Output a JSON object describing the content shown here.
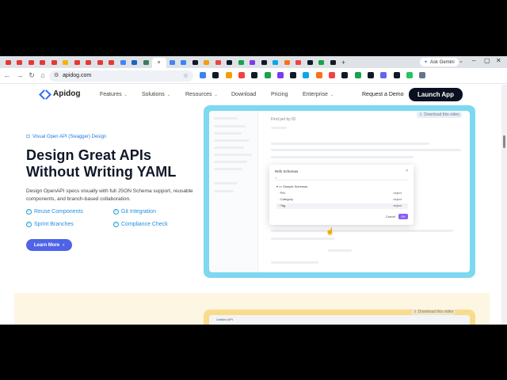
{
  "browser": {
    "tab_favicons": [
      "#e53935",
      "#e53935",
      "#e53935",
      "#e53935",
      "#e53935",
      "#f4b400",
      "#e53935",
      "#e53935",
      "#e53935",
      "#e53935",
      "#4285f4",
      "#1565c0",
      "#3a7c5a",
      "#4285f4"
    ],
    "active_tab_close": "×",
    "new_tab": "+",
    "ask_gemini": "Ask Gemini",
    "url": "apidog.com",
    "ext_colors": [
      "#3b82f6",
      "#111827",
      "#f59e0b",
      "#ef4444",
      "#111827",
      "#16a34a",
      "#7c3aed",
      "#111827",
      "#0ea5e9",
      "#f97316",
      "#ef4444",
      "#111827",
      "#16a34a",
      "#111827",
      "#6366f1",
      "#111827",
      "#22c55e",
      "#64748b"
    ]
  },
  "site": {
    "brand": "Apidog",
    "nav": [
      {
        "label": "Features",
        "caret": "⌄"
      },
      {
        "label": "Solutions",
        "caret": "⌄"
      },
      {
        "label": "Resources",
        "caret": "⌄"
      },
      {
        "label": "Download",
        "caret": ""
      },
      {
        "label": "Pricing",
        "caret": ""
      },
      {
        "label": "Enterprise",
        "caret": "⌄"
      }
    ],
    "request_demo": "Request a Demo",
    "launch_app": "Launch App"
  },
  "hero": {
    "kicker": "Visual Open API (Swagger) Design",
    "title_line1": "Design Great APIs",
    "title_line2": "Without Writing YAML",
    "description": "Design OpenAPI specs visually with full JSON Schema support, reusable components, and branch-based collaboration.",
    "features": [
      "Reuse Components",
      "Git Integration",
      "Sprint Branches",
      "Compliance Check"
    ],
    "cta": "Learn More",
    "cta_arrow": "›"
  },
  "demo": {
    "download_chip": "Download this video",
    "search_placeholder": "Find pet by ID",
    "modal_title": "Refs Schemas",
    "modal_close": "×",
    "modal_group": "Sample Schemas",
    "modal_rows": [
      {
        "name": "Pet",
        "type": "object"
      },
      {
        "name": "Category",
        "type": "object"
      },
      {
        "name": "Tag",
        "type": "object"
      }
    ],
    "cancel": "Cancel",
    "ok": "OK"
  },
  "demo2": {
    "download_chip": "Download this video",
    "tab_label": "Untitled API"
  }
}
